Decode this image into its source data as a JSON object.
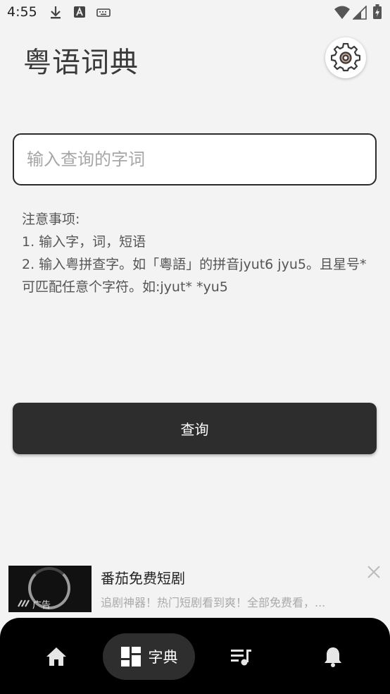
{
  "status_bar": {
    "time": "4:55"
  },
  "header": {
    "title": "粤语词典"
  },
  "search": {
    "placeholder": "输入查询的字词",
    "value": ""
  },
  "notes": {
    "heading": "注意事项:",
    "line1": "1. 输入字，词，短语",
    "line2": "2. 输入粤拼查字。如「粵語」的拼音jyut6  jyu5。且星号*可匹配任意个字符。如:jyut*  *yu5"
  },
  "query_button": {
    "label": "查询"
  },
  "ad": {
    "badge": "广告",
    "title": "番茄免费短剧",
    "description": "追剧神器！热门短剧看到爽！全部免费看，..."
  },
  "bottom_nav": {
    "items": [
      {
        "icon": "home-icon"
      },
      {
        "icon": "dictionary-icon",
        "label": "字典",
        "active": true
      },
      {
        "icon": "playlist-icon"
      },
      {
        "icon": "bell-icon"
      }
    ]
  },
  "colors": {
    "accent": "#2d2d2d",
    "background": "#f3f3f3",
    "nav_bg": "#000000"
  }
}
